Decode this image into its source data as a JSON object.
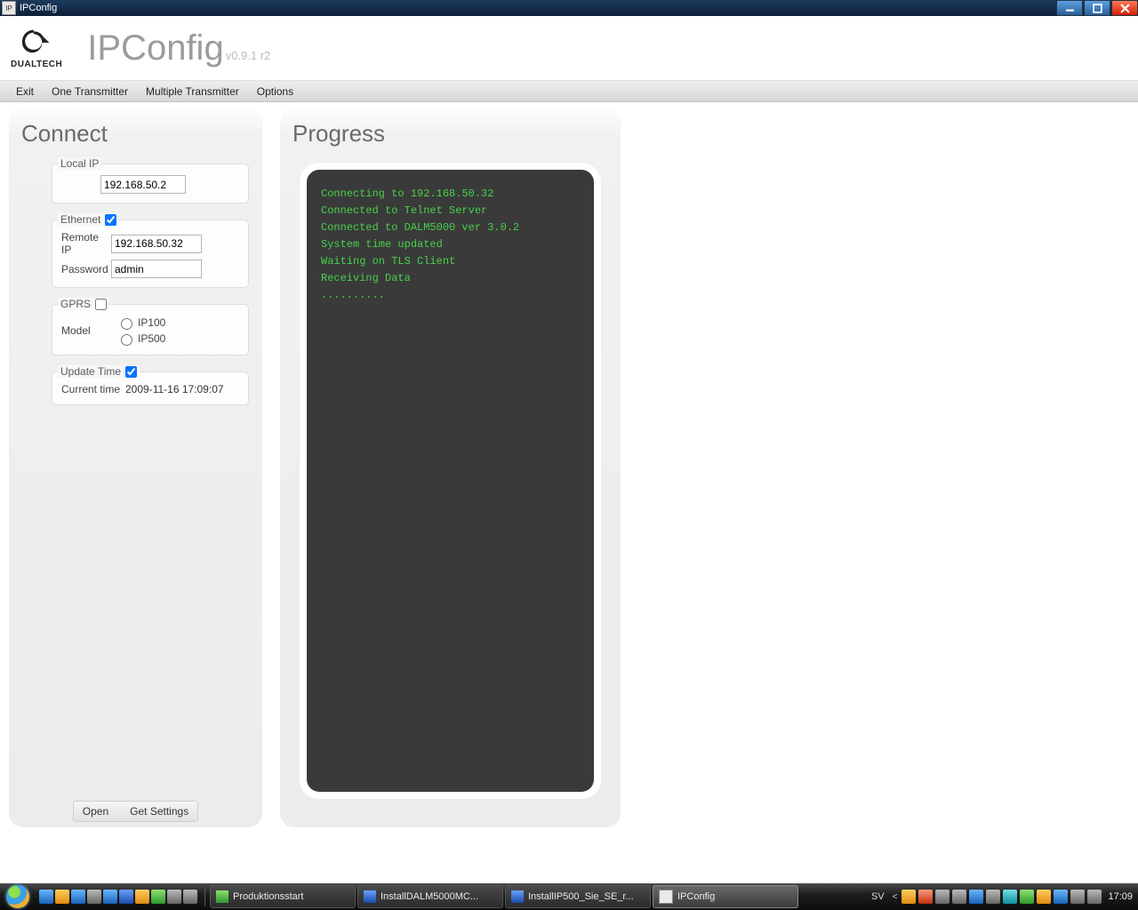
{
  "window": {
    "title": "IPConfig"
  },
  "header": {
    "brand": "DUALTECH",
    "appname": "IPConfig",
    "version": "v0.9.1 r2"
  },
  "menu": {
    "exit": "Exit",
    "one": "One Transmitter",
    "multi": "Multiple Transmitter",
    "options": "Options"
  },
  "connect": {
    "title": "Connect",
    "local_ip_label": "Local IP",
    "local_ip": "192.168.50.2",
    "ethernet_label": "Ethernet",
    "ethernet_checked": true,
    "remote_ip_label": "Remote IP",
    "remote_ip": "192.168.50.32",
    "password_label": "Password",
    "password": "admin",
    "gprs_label": "GPRS",
    "gprs_checked": false,
    "model_label": "Model",
    "model_options": {
      "ip100": "IP100",
      "ip500": "IP500"
    },
    "update_time_label": "Update Time",
    "update_time_checked": true,
    "current_time_label": "Current time",
    "current_time": "2009-11-16 17:09:07",
    "open_btn": "Open",
    "getsettings_btn": "Get Settings"
  },
  "progress": {
    "title": "Progress",
    "lines": "Connecting to 192.168.50.32\nConnected to Telnet Server\nConnected to DALM5000 ver 3.0.2\nSystem time updated\nWaiting on TLS Client\nReceiving Data\n.........."
  },
  "taskbar": {
    "items": [
      {
        "label": "Produktionsstart"
      },
      {
        "label": "InstallDALM5000MC..."
      },
      {
        "label": "InstallIP500_Sie_SE_r..."
      },
      {
        "label": "IPConfig"
      }
    ],
    "lang": "SV",
    "clock": "17:09"
  }
}
